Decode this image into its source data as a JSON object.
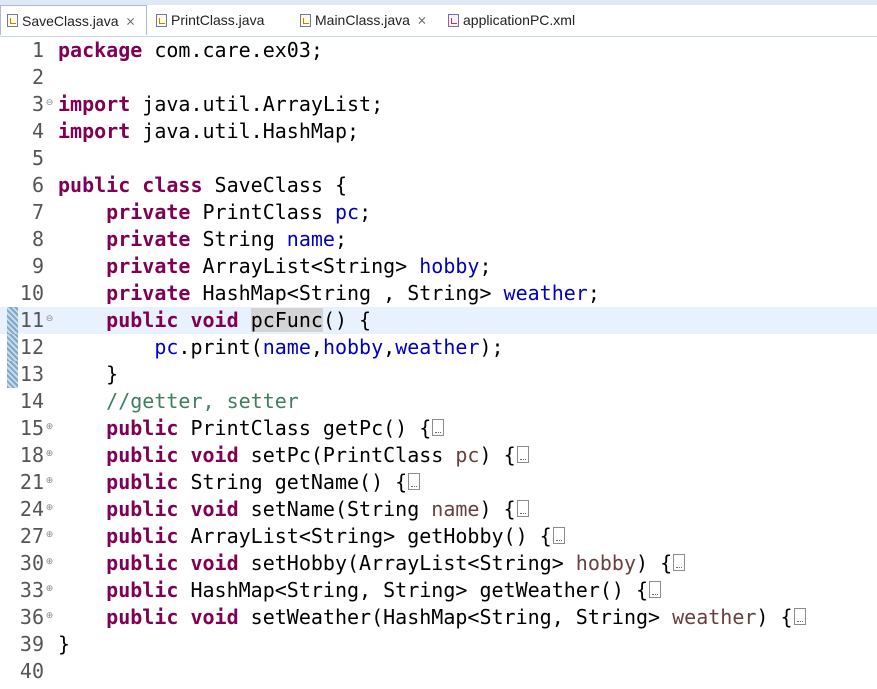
{
  "tabs": [
    {
      "label": "SaveClass.java",
      "icon": "java-file-icon",
      "active": true,
      "close": "⨯"
    },
    {
      "label": "PrintClass.java",
      "icon": "java-file-icon",
      "active": false,
      "close": ""
    },
    {
      "label": "MainClass.java",
      "icon": "java-file-icon",
      "active": false,
      "close": "⨯"
    },
    {
      "label": "applicationPC.xml",
      "icon": "xml-file-icon",
      "active": false,
      "close": ""
    }
  ],
  "editor": {
    "current_line": "11",
    "lines": [
      {
        "n": "1",
        "fold": "",
        "indent": "",
        "tokens": [
          [
            "kw",
            "package"
          ],
          [
            "",
            " com.care.ex03;"
          ]
        ]
      },
      {
        "n": "2",
        "fold": "",
        "indent": "",
        "tokens": []
      },
      {
        "n": "3",
        "fold": "⊖",
        "indent": "",
        "tokens": [
          [
            "kw",
            "import"
          ],
          [
            "",
            " java.util.ArrayList;"
          ]
        ]
      },
      {
        "n": "4",
        "fold": "",
        "indent": "",
        "tokens": [
          [
            "kw",
            "import"
          ],
          [
            "",
            " java.util.HashMap;"
          ]
        ]
      },
      {
        "n": "5",
        "fold": "",
        "indent": "",
        "tokens": []
      },
      {
        "n": "6",
        "fold": "",
        "indent": "",
        "tokens": [
          [
            "kw",
            "public"
          ],
          [
            "",
            " "
          ],
          [
            "kw",
            "class"
          ],
          [
            "",
            " SaveClass {"
          ]
        ]
      },
      {
        "n": "7",
        "fold": "",
        "indent": "    ",
        "tokens": [
          [
            "kw",
            "private"
          ],
          [
            "",
            " PrintClass "
          ],
          [
            "fld",
            "pc"
          ],
          [
            "",
            ";"
          ]
        ]
      },
      {
        "n": "8",
        "fold": "",
        "indent": "    ",
        "tokens": [
          [
            "kw",
            "private"
          ],
          [
            "",
            " String "
          ],
          [
            "fld",
            "name"
          ],
          [
            "",
            ";"
          ]
        ]
      },
      {
        "n": "9",
        "fold": "",
        "indent": "    ",
        "tokens": [
          [
            "kw",
            "private"
          ],
          [
            "",
            " ArrayList<String> "
          ],
          [
            "fld",
            "hobby"
          ],
          [
            "",
            ";"
          ]
        ]
      },
      {
        "n": "10",
        "fold": "",
        "indent": "    ",
        "tokens": [
          [
            "kw",
            "private"
          ],
          [
            "",
            " HashMap<String , String> "
          ],
          [
            "fld",
            "weather"
          ],
          [
            "",
            ";"
          ]
        ]
      },
      {
        "n": "11",
        "fold": "⊖",
        "indent": "    ",
        "tokens": [
          [
            "kw",
            "public"
          ],
          [
            "",
            " "
          ],
          [
            "kw",
            "void"
          ],
          [
            "",
            " "
          ],
          [
            "hl",
            "pcFunc"
          ],
          [
            "",
            "() {"
          ]
        ]
      },
      {
        "n": "12",
        "fold": "",
        "indent": "        ",
        "tokens": [
          [
            "fld",
            "pc"
          ],
          [
            "",
            ".print("
          ],
          [
            "fld",
            "name"
          ],
          [
            "",
            ","
          ],
          [
            "fld",
            "hobby"
          ],
          [
            "",
            ","
          ],
          [
            "fld",
            "weather"
          ],
          [
            "",
            ");"
          ]
        ]
      },
      {
        "n": "13",
        "fold": "",
        "indent": "    ",
        "tokens": [
          [
            "",
            "}"
          ]
        ]
      },
      {
        "n": "14",
        "fold": "",
        "indent": "    ",
        "tokens": [
          [
            "cmt",
            "//getter, setter"
          ]
        ]
      },
      {
        "n": "15",
        "fold": "⊕",
        "indent": "    ",
        "tokens": [
          [
            "kw",
            "public"
          ],
          [
            "",
            " PrintClass getPc() {"
          ],
          [
            "fb",
            ""
          ]
        ]
      },
      {
        "n": "18",
        "fold": "⊕",
        "indent": "    ",
        "tokens": [
          [
            "kw",
            "public"
          ],
          [
            "",
            " "
          ],
          [
            "kw",
            "void"
          ],
          [
            "",
            " setPc(PrintClass "
          ],
          [
            "par",
            "pc"
          ],
          [
            "",
            ") {"
          ],
          [
            "fb",
            ""
          ]
        ]
      },
      {
        "n": "21",
        "fold": "⊕",
        "indent": "    ",
        "tokens": [
          [
            "kw",
            "public"
          ],
          [
            "",
            " String getName() {"
          ],
          [
            "fb",
            ""
          ]
        ]
      },
      {
        "n": "24",
        "fold": "⊕",
        "indent": "    ",
        "tokens": [
          [
            "kw",
            "public"
          ],
          [
            "",
            " "
          ],
          [
            "kw",
            "void"
          ],
          [
            "",
            " setName(String "
          ],
          [
            "par",
            "name"
          ],
          [
            "",
            ") {"
          ],
          [
            "fb",
            ""
          ]
        ]
      },
      {
        "n": "27",
        "fold": "⊕",
        "indent": "    ",
        "tokens": [
          [
            "kw",
            "public"
          ],
          [
            "",
            " ArrayList<String> getHobby() {"
          ],
          [
            "fb",
            ""
          ]
        ]
      },
      {
        "n": "30",
        "fold": "⊕",
        "indent": "    ",
        "tokens": [
          [
            "kw",
            "public"
          ],
          [
            "",
            " "
          ],
          [
            "kw",
            "void"
          ],
          [
            "",
            " setHobby(ArrayList<String> "
          ],
          [
            "par",
            "hobby"
          ],
          [
            "",
            ") {"
          ],
          [
            "fb",
            ""
          ]
        ]
      },
      {
        "n": "33",
        "fold": "⊕",
        "indent": "    ",
        "tokens": [
          [
            "kw",
            "public"
          ],
          [
            "",
            " HashMap<String, String> getWeather() {"
          ],
          [
            "fb",
            ""
          ]
        ]
      },
      {
        "n": "36",
        "fold": "⊕",
        "indent": "    ",
        "tokens": [
          [
            "kw",
            "public"
          ],
          [
            "",
            " "
          ],
          [
            "kw",
            "void"
          ],
          [
            "",
            " setWeather(HashMap<String, String> "
          ],
          [
            "par",
            "weather"
          ],
          [
            "",
            ") {"
          ],
          [
            "fb",
            ""
          ]
        ]
      },
      {
        "n": "39",
        "fold": "",
        "indent": "",
        "tokens": [
          [
            "",
            "}"
          ]
        ]
      },
      {
        "n": "40",
        "fold": "",
        "indent": "",
        "tokens": []
      }
    ]
  }
}
